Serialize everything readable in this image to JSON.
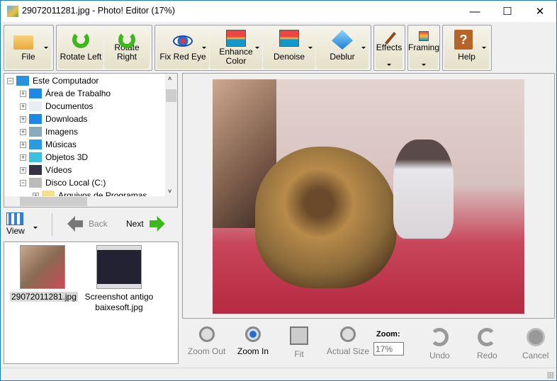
{
  "window": {
    "title": "29072011281.jpg - Photo! Editor (17%)",
    "minimize": "—",
    "maximize": "☐",
    "close": "✕"
  },
  "toolbar": {
    "file": "File",
    "rotate_left": "Rotate Left",
    "rotate_right": "Rotate Right",
    "fix_red_eye": "Fix Red Eye",
    "enhance_color": "Enhance Color",
    "denoise": "Denoise",
    "deblur": "Deblur",
    "effects": "Effects",
    "framing": "Framing",
    "help": "Help"
  },
  "tree": {
    "items": [
      {
        "label": "Este Computador",
        "icon": "computer-icon",
        "expanded": true
      },
      {
        "label": "Área de Trabalho",
        "icon": "desktop-icon"
      },
      {
        "label": "Documentos",
        "icon": "documents-icon"
      },
      {
        "label": "Downloads",
        "icon": "downloads-icon"
      },
      {
        "label": "Imagens",
        "icon": "images-icon"
      },
      {
        "label": "Músicas",
        "icon": "music-icon"
      },
      {
        "label": "Objetos 3D",
        "icon": "3d-objects-icon"
      },
      {
        "label": "Vídeos",
        "icon": "videos-icon"
      },
      {
        "label": "Disco Local (C:)",
        "icon": "drive-icon",
        "expanded": true
      },
      {
        "label": "Arquivos de Programas",
        "icon": "folder-icon"
      }
    ]
  },
  "nav": {
    "view": "View",
    "back": "Back",
    "next": "Next"
  },
  "thumbnails": [
    {
      "name": "29072011281.jpg",
      "selected": true
    },
    {
      "name": "Screenshot antigo baixesoft.jpg"
    }
  ],
  "bottom": {
    "zoom_out": "Zoom Out",
    "zoom_in": "Zoom In",
    "fit": "Fit",
    "actual_size": "Actual Size",
    "zoom_label": "Zoom:",
    "zoom_value": "17%",
    "undo": "Undo",
    "redo": "Redo",
    "cancel": "Cancel"
  },
  "colors": {
    "accent": "#1979ca",
    "toolbar_button": "#e8e4d0",
    "arrow_green": "#3cb81c"
  }
}
